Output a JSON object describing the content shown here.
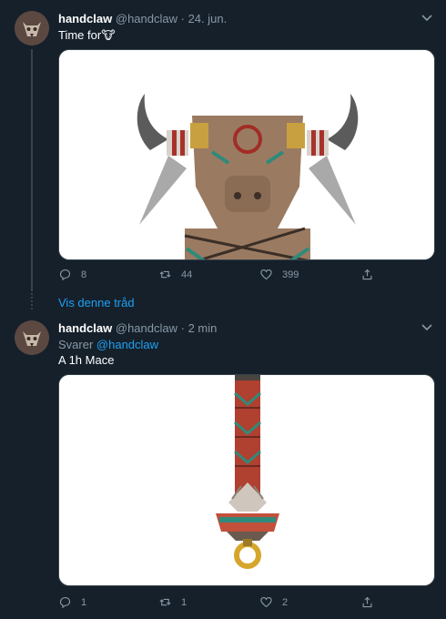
{
  "tweet1": {
    "name": "handclaw",
    "handle": "@handclaw",
    "time": "· 24. jun.",
    "text": "Time for",
    "emoji": "🐮",
    "image_icon": "bull-totem-illustration",
    "replies": "8",
    "retweets": "44",
    "likes": "399"
  },
  "show_thread": "Vis denne tråd",
  "tweet2": {
    "name": "handclaw",
    "handle": "@handclaw",
    "time": "· 2 min",
    "reply_prefix": "Svarer",
    "reply_mention": "@handclaw",
    "text": "A 1h Mace",
    "image_icon": "mace-illustration",
    "replies": "1",
    "retweets": "1",
    "likes": "2"
  },
  "colors": {
    "background": "#15202b",
    "muted": "#8899a6",
    "accent": "#1da1f2",
    "divider": "#38444d"
  }
}
